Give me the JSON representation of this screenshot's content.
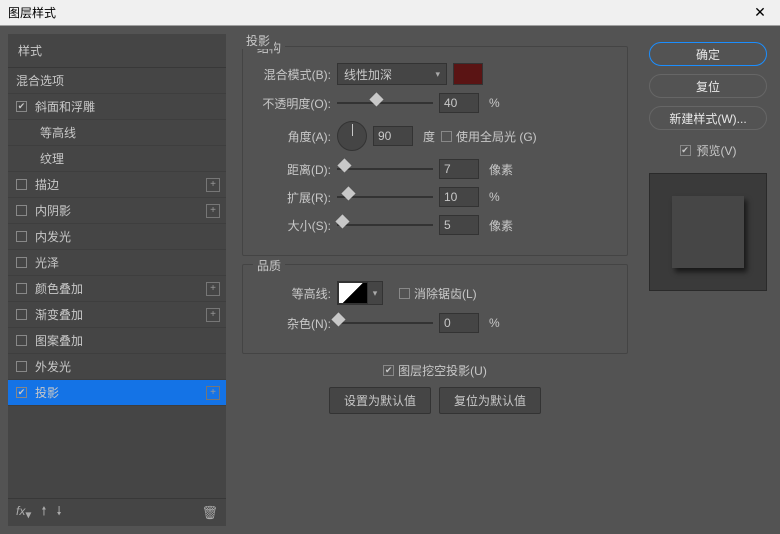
{
  "window": {
    "title": "图层样式"
  },
  "sidebar": {
    "header": "样式",
    "blending": "混合选项",
    "items": [
      {
        "label": "斜面和浮雕",
        "checked": true,
        "plus": false,
        "indent": false
      },
      {
        "label": "等高线",
        "checked": false,
        "plus": false,
        "indent": true
      },
      {
        "label": "纹理",
        "checked": false,
        "plus": false,
        "indent": true
      },
      {
        "label": "描边",
        "checked": false,
        "plus": true,
        "indent": false
      },
      {
        "label": "内阴影",
        "checked": false,
        "plus": true,
        "indent": false
      },
      {
        "label": "内发光",
        "checked": false,
        "plus": false,
        "indent": false
      },
      {
        "label": "光泽",
        "checked": false,
        "plus": false,
        "indent": false
      },
      {
        "label": "颜色叠加",
        "checked": false,
        "plus": true,
        "indent": false
      },
      {
        "label": "渐变叠加",
        "checked": false,
        "plus": true,
        "indent": false
      },
      {
        "label": "图案叠加",
        "checked": false,
        "plus": false,
        "indent": false
      },
      {
        "label": "外发光",
        "checked": false,
        "plus": false,
        "indent": false
      },
      {
        "label": "投影",
        "checked": true,
        "plus": true,
        "indent": false,
        "selected": true
      }
    ],
    "footer_fx": "fx"
  },
  "main": {
    "title": "投影",
    "structure": {
      "legend": "结构",
      "blend_label": "混合模式(B):",
      "blend_value": "线性加深",
      "color": "#5a1414",
      "opacity_label": "不透明度(O):",
      "opacity_value": "40",
      "opacity_unit": "%",
      "angle_label": "角度(A):",
      "angle_value": "90",
      "angle_unit": "度",
      "global_light": "使用全局光 (G)",
      "distance_label": "距离(D):",
      "distance_value": "7",
      "distance_unit": "像素",
      "spread_label": "扩展(R):",
      "spread_value": "10",
      "spread_unit": "%",
      "size_label": "大小(S):",
      "size_value": "5",
      "size_unit": "像素"
    },
    "quality": {
      "legend": "品质",
      "contour_label": "等高线:",
      "antialias": "消除锯齿(L)",
      "noise_label": "杂色(N):",
      "noise_value": "0",
      "noise_unit": "%"
    },
    "knockout": "图层挖空投影(U)",
    "btn_default": "设置为默认值",
    "btn_reset": "复位为默认值"
  },
  "right": {
    "ok": "确定",
    "cancel": "复位",
    "new_style": "新建样式(W)...",
    "preview": "预览(V)"
  }
}
